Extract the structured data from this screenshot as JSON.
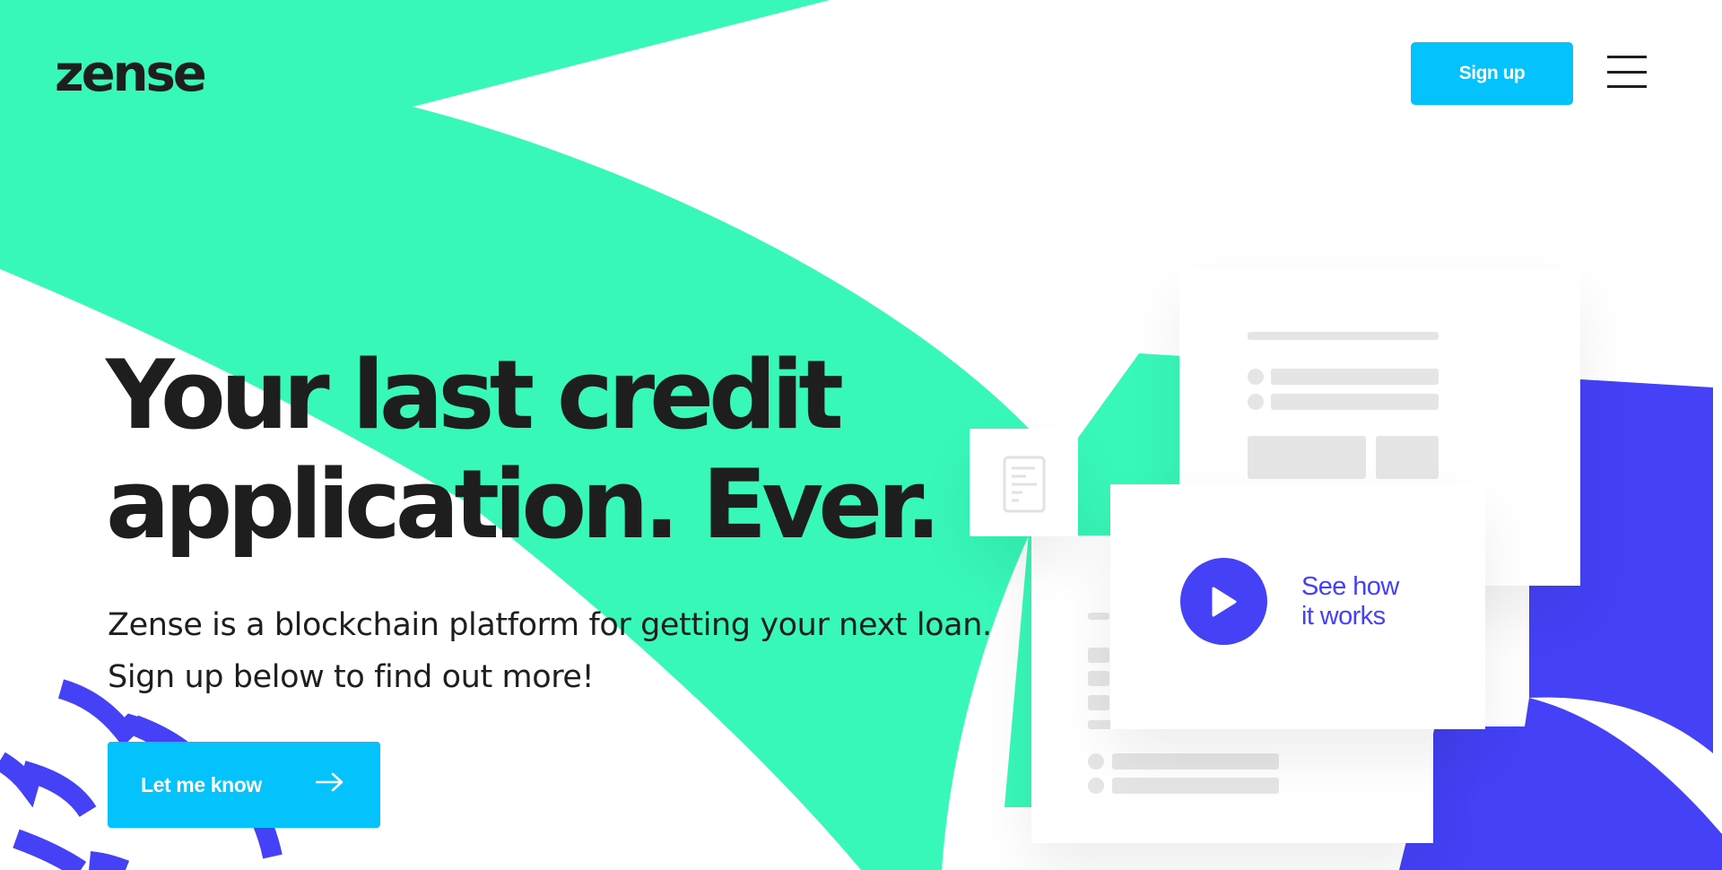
{
  "header": {
    "logo_text": "zense",
    "signup_label": "Sign up",
    "menu_icon": "hamburger-menu-icon"
  },
  "hero": {
    "title_line1": "Your last credit",
    "title_line2": "application. Ever.",
    "subtitle_line1": "Zense is a blockchain platform for getting your next loan.",
    "subtitle_line2": "Sign up below to find out more!",
    "cta_label": "Let me know",
    "cta_icon": "arrow-right-icon"
  },
  "illustration": {
    "video_label_line1": "See how",
    "video_label_line2": "it works",
    "play_icon": "play-icon",
    "document_icon": "document-icon"
  },
  "colors": {
    "mint": "#38f8b9",
    "blue_accent": "#4441f6",
    "cyan_button": "#04c2fb",
    "text_dark": "#1e1e1e",
    "placeholder_gray": "#e5e5e5"
  }
}
